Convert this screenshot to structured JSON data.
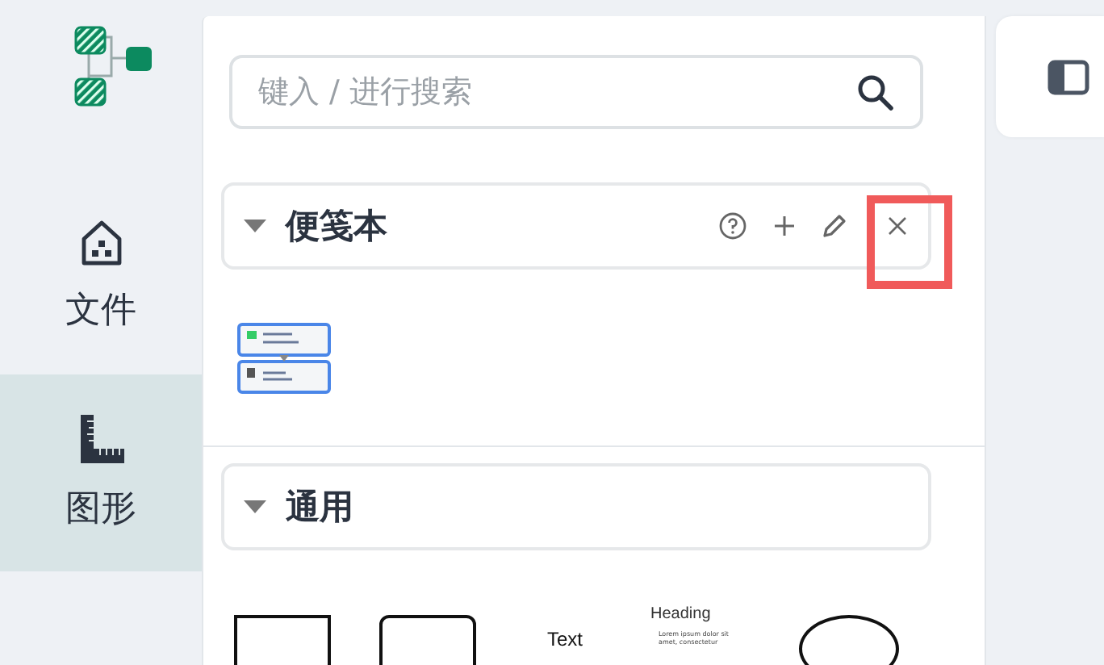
{
  "sidebar": {
    "items": [
      {
        "label": "文件",
        "selected": false
      },
      {
        "label": "图形",
        "selected": true
      }
    ]
  },
  "search": {
    "placeholder": "键入 / 进行搜索"
  },
  "sections": [
    {
      "title": "便笺本",
      "expanded": true,
      "actions": true,
      "highlight_close": true,
      "kind": "scratchpad"
    },
    {
      "title": "通用",
      "expanded": true,
      "kind": "shapes",
      "shapes": [
        {
          "kind": "rect"
        },
        {
          "kind": "rounded"
        },
        {
          "kind": "text",
          "label": "Text"
        },
        {
          "kind": "heading",
          "label": "Heading",
          "body": "Lorem ipsum dolor sit amet, consectetur"
        },
        {
          "kind": "ellipse"
        }
      ]
    }
  ]
}
